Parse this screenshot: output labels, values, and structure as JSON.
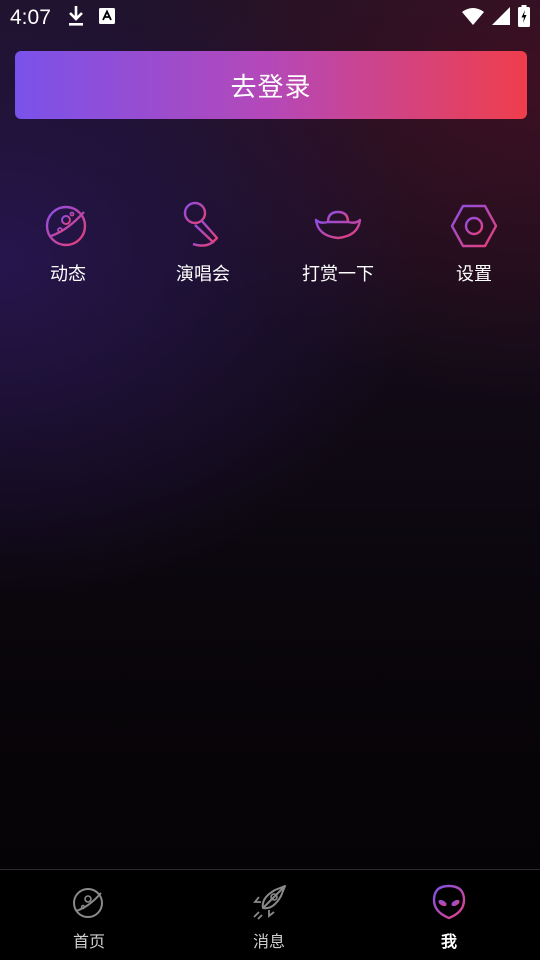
{
  "status_bar": {
    "time": "4:07",
    "icons": [
      "download-icon",
      "a-icon",
      "wifi-icon",
      "signal-icon",
      "battery-icon"
    ]
  },
  "login": {
    "label": "去登录"
  },
  "menu": {
    "items": [
      {
        "label": "动态",
        "icon": "planet-icon"
      },
      {
        "label": "演唱会",
        "icon": "microphone-icon"
      },
      {
        "label": "打赏一下",
        "icon": "gold-ingot-icon"
      },
      {
        "label": "设置",
        "icon": "hexagon-settings-icon"
      }
    ]
  },
  "tabbar": {
    "items": [
      {
        "label": "首页",
        "icon": "planet-icon",
        "active": false
      },
      {
        "label": "消息",
        "icon": "rocket-icon",
        "active": false
      },
      {
        "label": "我",
        "icon": "alien-icon",
        "active": true
      }
    ]
  },
  "colors": {
    "accent_start": "#7a52ea",
    "accent_end": "#ef3e4c",
    "tab_active_icon": "#b84bd6"
  }
}
